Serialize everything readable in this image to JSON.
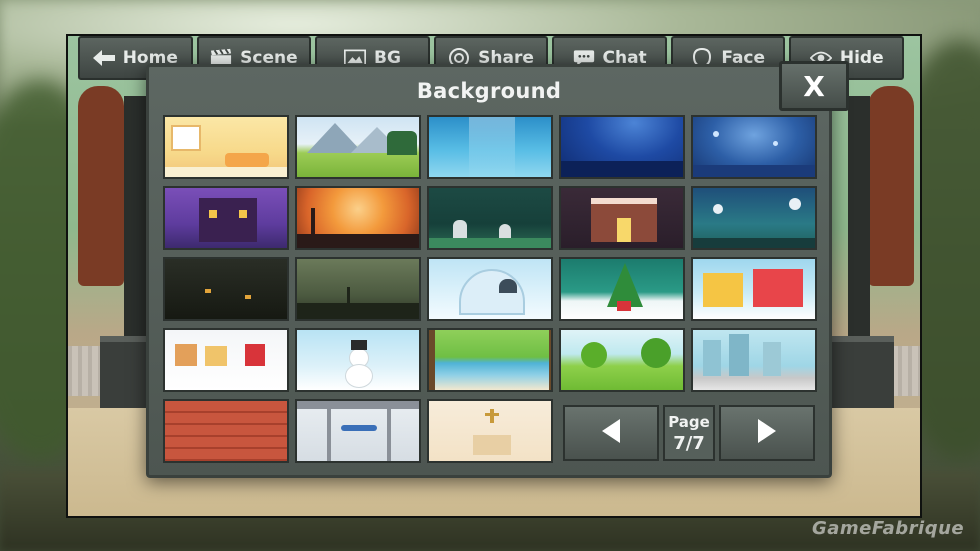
{
  "toolbar": {
    "buttons": [
      {
        "label": "Home",
        "icon": "arrow-left-icon"
      },
      {
        "label": "Scene",
        "icon": "clapperboard-icon"
      },
      {
        "label": "BG",
        "icon": "image-icon"
      },
      {
        "label": "Share",
        "icon": "share-icon"
      },
      {
        "label": "Chat",
        "icon": "chat-bubble-icon"
      },
      {
        "label": "Face",
        "icon": "face-icon"
      },
      {
        "label": "Hide",
        "icon": "eye-icon"
      }
    ]
  },
  "modal": {
    "title": "Background",
    "close_label": "X"
  },
  "backgrounds": [
    "living-room",
    "mountain-meadow",
    "underwater",
    "deep-sea",
    "night-sparkle",
    "haunted-house",
    "halloween-orange-moon",
    "graveyard-night",
    "gingerbread-haunted-house",
    "bats-night-sky",
    "dark-forest-eyes",
    "misty-graveyard",
    "igloo",
    "christmas-tree",
    "winter-town-houses",
    "snowy-village",
    "snowman",
    "park-pond",
    "green-hills-trees",
    "city-skyline",
    "brick-wall",
    "airport-terminal",
    "chapel-altar"
  ],
  "pager": {
    "label": "Page",
    "value": "7/7",
    "current": 7,
    "total": 7
  },
  "watermark": "GameFabrique",
  "colors": {
    "panel": "#56605b",
    "panel_border": "#2c322f",
    "text": "#f2f4f3"
  }
}
